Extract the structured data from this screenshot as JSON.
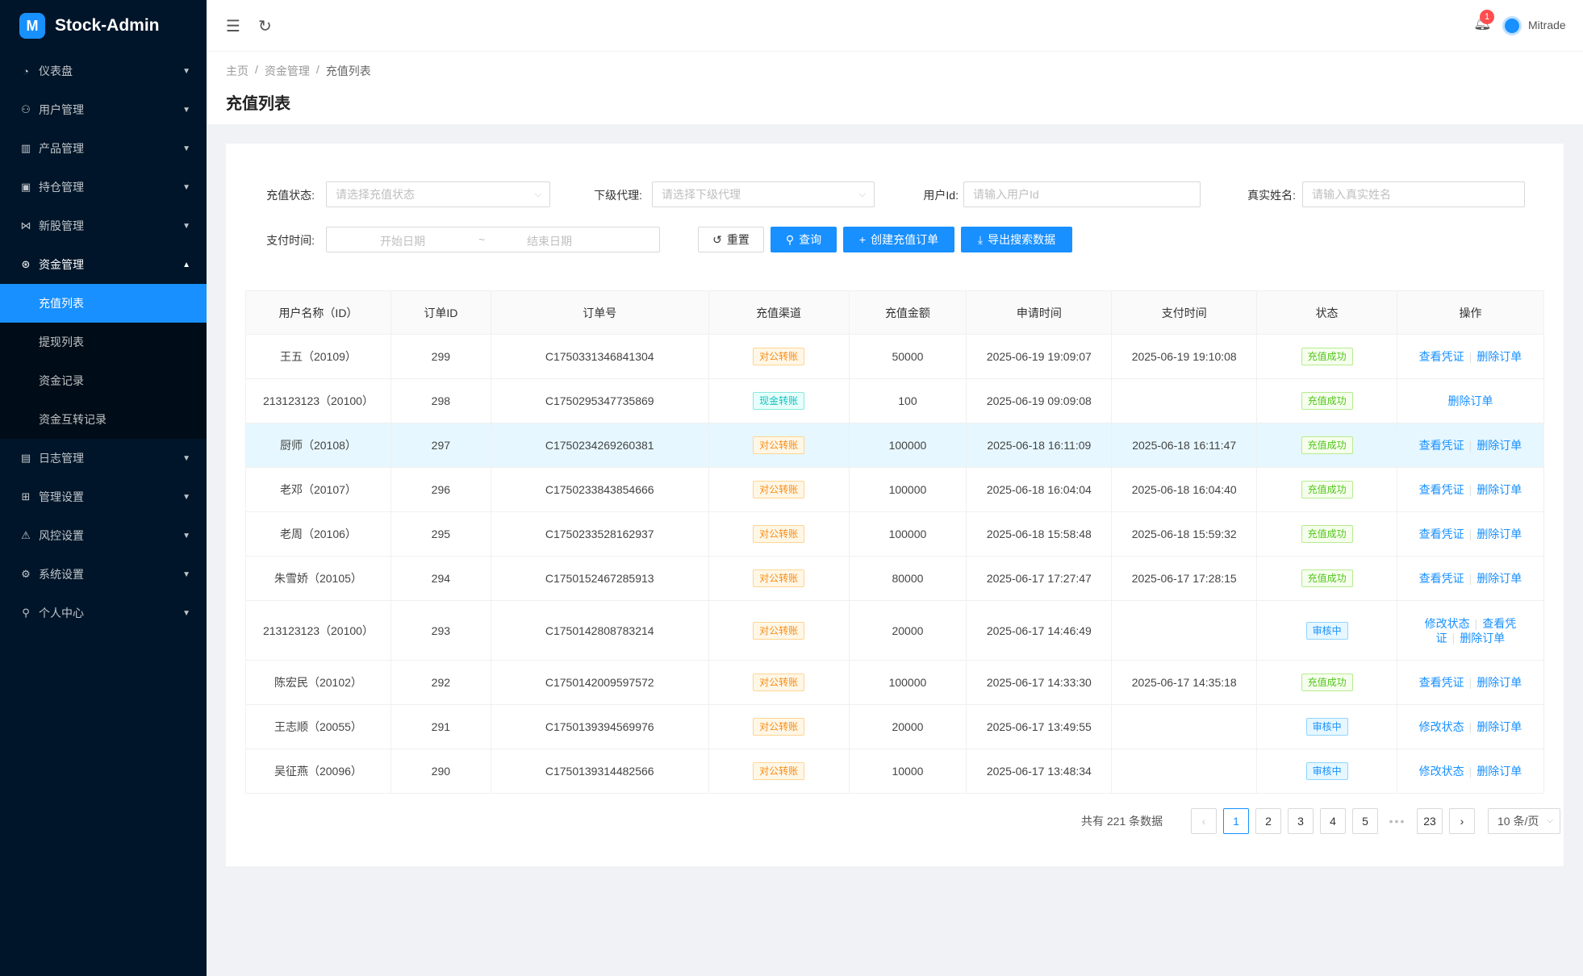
{
  "app": {
    "title": "Stock-Admin",
    "logo_glyph": "M"
  },
  "sidebar": {
    "items": [
      {
        "label": "仪表盘",
        "icon": "dashboard-icon",
        "glyph": "◔"
      },
      {
        "label": "用户管理",
        "icon": "users-icon",
        "glyph": "⚇"
      },
      {
        "label": "产品管理",
        "icon": "chart-icon",
        "glyph": "▥"
      },
      {
        "label": "持仓管理",
        "icon": "position-icon",
        "glyph": "▣"
      },
      {
        "label": "新股管理",
        "icon": "ipo-icon",
        "glyph": "⋈"
      },
      {
        "label": "资金管理",
        "icon": "money-icon",
        "glyph": "⊛",
        "open": true,
        "children": [
          "充值列表",
          "提现列表",
          "资金记录",
          "资金互转记录"
        ]
      },
      {
        "label": "日志管理",
        "icon": "log-icon",
        "glyph": "▤"
      },
      {
        "label": "管理设置",
        "icon": "admin-settings-icon",
        "glyph": "⊞"
      },
      {
        "label": "风控设置",
        "icon": "warning-icon",
        "glyph": "⚠"
      },
      {
        "label": "系统设置",
        "icon": "gear-icon",
        "glyph": "⚙"
      },
      {
        "label": "个人中心",
        "icon": "user-icon",
        "glyph": "⚲"
      }
    ],
    "active_child": "充值列表"
  },
  "header": {
    "notification_count": "1",
    "username": "Mitrade"
  },
  "breadcrumb": [
    "主页",
    "资金管理",
    "充值列表"
  ],
  "page_title": "充值列表",
  "filters": {
    "recharge_status_label": "充值状态:",
    "recharge_status_placeholder": "请选择充值状态",
    "agent_label": "下级代理:",
    "agent_placeholder": "请选择下级代理",
    "user_id_label": "用户Id:",
    "user_id_placeholder": "请输入用户Id",
    "real_name_label": "真实姓名:",
    "real_name_placeholder": "请输入真实姓名",
    "pay_time_label": "支付时间:",
    "start_date_placeholder": "开始日期",
    "end_date_placeholder": "结束日期",
    "range_separator": "~"
  },
  "buttons": {
    "reset": "重置",
    "search": "查询",
    "create": "创建充值订单",
    "export": "导出搜索数据"
  },
  "table": {
    "columns": [
      "用户名称（ID）",
      "订单ID",
      "订单号",
      "充值渠道",
      "充值金额",
      "申请时间",
      "支付时间",
      "状态",
      "操作"
    ],
    "rows": [
      {
        "user": "王五（20109）",
        "id": "299",
        "order_no": "C1750331346841304",
        "channel": "对公转账",
        "channel_type": "orange",
        "amount": "50000",
        "apply_time": "2025-06-19 19:09:07",
        "pay_time": "2025-06-19 19:10:08",
        "status": "充值成功",
        "status_type": "green",
        "actions": [
          "查看凭证",
          "删除订单"
        ]
      },
      {
        "user": "213123123（20100）",
        "id": "298",
        "order_no": "C1750295347735869",
        "channel": "现金转账",
        "channel_type": "cyan",
        "amount": "100",
        "apply_time": "2025-06-19 09:09:08",
        "pay_time": "",
        "status": "充值成功",
        "status_type": "green",
        "actions": [
          "删除订单"
        ]
      },
      {
        "user": "厨师（20108）",
        "id": "297",
        "order_no": "C1750234269260381",
        "channel": "对公转账",
        "channel_type": "orange",
        "amount": "100000",
        "apply_time": "2025-06-18 16:11:09",
        "pay_time": "2025-06-18 16:11:47",
        "status": "充值成功",
        "status_type": "green",
        "actions": [
          "查看凭证",
          "删除订单"
        ],
        "highlight": true
      },
      {
        "user": "老邓（20107）",
        "id": "296",
        "order_no": "C1750233843854666",
        "channel": "对公转账",
        "channel_type": "orange",
        "amount": "100000",
        "apply_time": "2025-06-18 16:04:04",
        "pay_time": "2025-06-18 16:04:40",
        "status": "充值成功",
        "status_type": "green",
        "actions": [
          "查看凭证",
          "删除订单"
        ]
      },
      {
        "user": "老周（20106）",
        "id": "295",
        "order_no": "C1750233528162937",
        "channel": "对公转账",
        "channel_type": "orange",
        "amount": "100000",
        "apply_time": "2025-06-18 15:58:48",
        "pay_time": "2025-06-18 15:59:32",
        "status": "充值成功",
        "status_type": "green",
        "actions": [
          "查看凭证",
          "删除订单"
        ]
      },
      {
        "user": "朱雪娇（20105）",
        "id": "294",
        "order_no": "C1750152467285913",
        "channel": "对公转账",
        "channel_type": "orange",
        "amount": "80000",
        "apply_time": "2025-06-17 17:27:47",
        "pay_time": "2025-06-17 17:28:15",
        "status": "充值成功",
        "status_type": "green",
        "actions": [
          "查看凭证",
          "删除订单"
        ]
      },
      {
        "user": "213123123（20100）",
        "id": "293",
        "order_no": "C1750142808783214",
        "channel": "对公转账",
        "channel_type": "orange",
        "amount": "20000",
        "apply_time": "2025-06-17 14:46:49",
        "pay_time": "",
        "status": "审核中",
        "status_type": "blue",
        "actions": [
          "修改状态",
          "查看凭证",
          "删除订单"
        ],
        "tall": true
      },
      {
        "user": "陈宏民（20102）",
        "id": "292",
        "order_no": "C1750142009597572",
        "channel": "对公转账",
        "channel_type": "orange",
        "amount": "100000",
        "apply_time": "2025-06-17 14:33:30",
        "pay_time": "2025-06-17 14:35:18",
        "status": "充值成功",
        "status_type": "green",
        "actions": [
          "查看凭证",
          "删除订单"
        ]
      },
      {
        "user": "王志顺（20055）",
        "id": "291",
        "order_no": "C1750139394569976",
        "channel": "对公转账",
        "channel_type": "orange",
        "amount": "20000",
        "apply_time": "2025-06-17 13:49:55",
        "pay_time": "",
        "status": "审核中",
        "status_type": "blue",
        "actions": [
          "修改状态",
          "删除订单"
        ]
      },
      {
        "user": "吴征燕（20096）",
        "id": "290",
        "order_no": "C1750139314482566",
        "channel": "对公转账",
        "channel_type": "orange",
        "amount": "10000",
        "apply_time": "2025-06-17 13:48:34",
        "pay_time": "",
        "status": "审核中",
        "status_type": "blue",
        "actions": [
          "修改状态",
          "删除订单"
        ]
      }
    ]
  },
  "pagination": {
    "total_text": "共有 221 条数据",
    "pages": [
      "1",
      "2",
      "3",
      "4",
      "5"
    ],
    "current": "1",
    "last_page": "23",
    "ellipsis": "•••",
    "prev": "‹",
    "next": "›",
    "page_size": "10 条/页"
  }
}
